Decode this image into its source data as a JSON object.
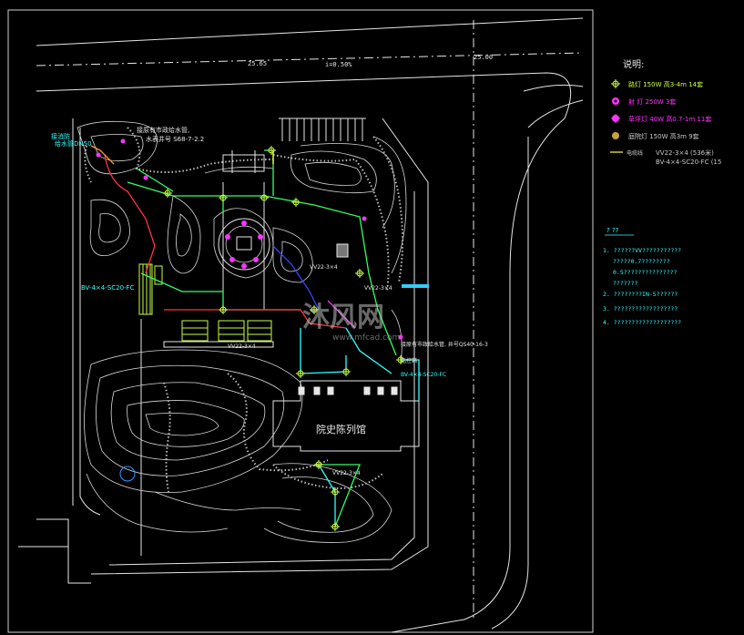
{
  "road": {
    "elev_left": "25.65",
    "slope": "i=0.50%",
    "elev_right": "25.00"
  },
  "annotations": {
    "top_left_a": "给水管DN50",
    "top_left_b": "接消防",
    "top_label_1": "接原有市政给水管,",
    "top_label_2": "水表井号 S68-7-2.2",
    "left_cable": "BV-4×4-SC20-FC",
    "center_cable_1": "VV22-3×4",
    "center_cable_2": "VV22-3×4",
    "right_cable_1": "VV22-3×4",
    "right_note_1": "接原有市政给水管, 井号QS40-16-3",
    "right_note_2": "电控箱",
    "right_note_3": "BV-4×4-SC20-FC",
    "bottom_cable": "VV22-3×4",
    "building_name": "院史陈列馆"
  },
  "legend": {
    "title": "说明:",
    "items": [
      {
        "label": "路灯 150W 高3-4m 14套",
        "color": "#c8ff40",
        "icon": "streetlight-icon"
      },
      {
        "label": "射 灯 250W 3套",
        "color": "#ff33ff",
        "icon": "spotlight-icon"
      },
      {
        "label": "草坪灯 40W 高0.7-1m 11套",
        "color": "#ff33ff",
        "icon": "lawn-lamp-icon"
      },
      {
        "label": "庭院灯 150W 高3m 9套",
        "color": "#c8a040",
        "icon": "garden-lamp-icon"
      }
    ],
    "cable_label": "电缆线",
    "cable_spec_1": "VV22-3×4 (536米)",
    "cable_spec_2": "BV-4×4-SC20-FC (15"
  },
  "notes": {
    "title": "? ??",
    "lines": [
      "1. ??????VV???????????",
      "?????0.7????????",
      "0.5???????????????",
      "???????",
      "2. ????????IN-S??????",
      "3. ??????????????????",
      "4. ???????????????????"
    ]
  },
  "watermark": {
    "text_cn": "沐风网",
    "text_en": "www.mfcad.com"
  },
  "colors": {
    "background": "#000000",
    "linework": "#e6e6e6",
    "cable_green": "#33ff66",
    "cable_cyan": "#33ffff",
    "cable_magenta": "#ff33ff",
    "cable_blue": "#3344ff",
    "cable_red": "#ff3344",
    "cable_yellow": "#ffff44",
    "accent_orange": "#ff9933"
  }
}
